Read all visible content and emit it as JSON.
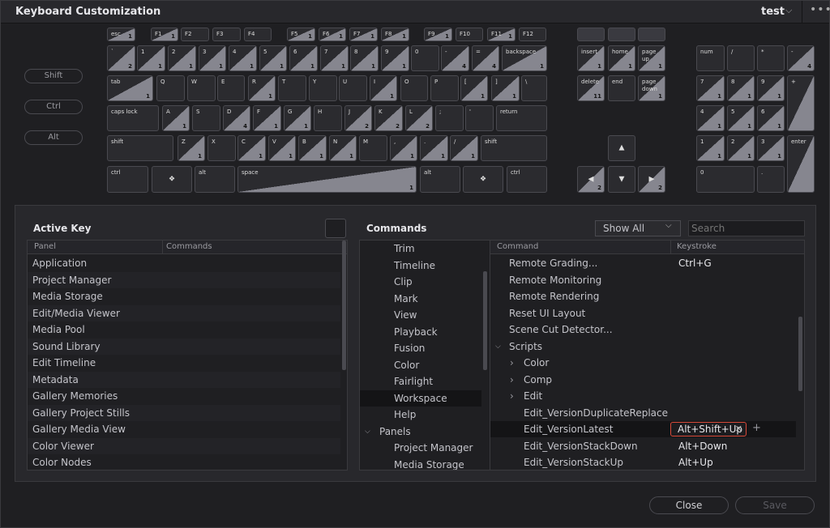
{
  "title": "Keyboard Customization",
  "preset": "test",
  "modifiers": [
    "Shift",
    "Ctrl",
    "Alt"
  ],
  "keys": [
    [
      "esc",
      "1",
      1
    ],
    [
      "F1",
      "1",
      1
    ],
    [
      "F2",
      "",
      0
    ],
    [
      "F3",
      "",
      0
    ],
    [
      "F4",
      "",
      0
    ],
    [
      "F5",
      "1",
      1
    ],
    [
      "F6",
      "1",
      1
    ],
    [
      "F7",
      "1",
      1
    ],
    [
      "F8",
      "1",
      1
    ],
    [
      "F9",
      "1",
      1
    ],
    [
      "F10",
      "",
      0
    ],
    [
      "F11",
      "1",
      1
    ],
    [
      "F12",
      "",
      0
    ],
    [
      "",
      "",
      0
    ],
    [
      "",
      "",
      0
    ],
    [
      "",
      "",
      0
    ],
    [
      "`",
      "2",
      1
    ],
    [
      "1",
      "1",
      1
    ],
    [
      "2",
      "1",
      1
    ],
    [
      "3",
      "1",
      1
    ],
    [
      "4",
      "1",
      1
    ],
    [
      "5",
      "1",
      1
    ],
    [
      "6",
      "1",
      1
    ],
    [
      "7",
      "1",
      1
    ],
    [
      "8",
      "1",
      1
    ],
    [
      "9",
      "1",
      1
    ],
    [
      "0",
      "",
      0
    ],
    [
      "-",
      "4",
      1
    ],
    [
      "=",
      "4",
      1
    ],
    [
      "backspace",
      "1",
      1
    ],
    [
      "insert",
      "1",
      1
    ],
    [
      "home",
      "1",
      1
    ],
    [
      "page up",
      "1",
      1
    ],
    [
      "num",
      "",
      0
    ],
    [
      "/",
      "",
      0
    ],
    [
      "*",
      "",
      0
    ],
    [
      "-",
      "4",
      1
    ],
    [
      "tab",
      "1",
      1
    ],
    [
      "Q",
      "",
      0
    ],
    [
      "W",
      "",
      0
    ],
    [
      "E",
      "",
      0
    ],
    [
      "R",
      "1",
      1
    ],
    [
      "T",
      "",
      0
    ],
    [
      "Y",
      "",
      0
    ],
    [
      "U",
      "",
      0
    ],
    [
      "I",
      "1",
      1
    ],
    [
      "O",
      "",
      0
    ],
    [
      "P",
      "",
      0
    ],
    [
      "[",
      "1",
      1
    ],
    [
      "]",
      "1",
      1
    ],
    [
      "\\",
      "",
      0
    ],
    [
      "delete",
      "11",
      1
    ],
    [
      "end",
      "",
      0
    ],
    [
      "page\ndown",
      "1",
      1
    ],
    [
      "7",
      "1",
      1
    ],
    [
      "8",
      "1",
      1
    ],
    [
      "9",
      "1",
      1
    ],
    [
      "+",
      "",
      1
    ],
    [
      "caps lock",
      "",
      0
    ],
    [
      "A",
      "1",
      1
    ],
    [
      "S",
      "",
      0
    ],
    [
      "D",
      "4",
      1
    ],
    [
      "F",
      "1",
      1
    ],
    [
      "G",
      "1",
      1
    ],
    [
      "H",
      "",
      0
    ],
    [
      "J",
      "2",
      1
    ],
    [
      "K",
      "2",
      1
    ],
    [
      "L",
      "2",
      1
    ],
    [
      ";",
      "",
      0
    ],
    [
      "'",
      "",
      0
    ],
    [
      "return",
      "",
      0
    ],
    [
      "4",
      "1",
      1
    ],
    [
      "5",
      "1",
      1
    ],
    [
      "6",
      "1",
      1
    ],
    [
      "shift",
      "",
      0
    ],
    [
      "Z",
      "1",
      1
    ],
    [
      "X",
      "",
      0
    ],
    [
      "C",
      "1",
      1
    ],
    [
      "V",
      "1",
      1
    ],
    [
      "B",
      "1",
      1
    ],
    [
      "N",
      "1",
      1
    ],
    [
      "M",
      "",
      0
    ],
    [
      ",",
      "1",
      1
    ],
    [
      ".",
      "1",
      1
    ],
    [
      "/",
      "1",
      1
    ],
    [
      "shift",
      "",
      0
    ],
    [
      "▲",
      "",
      0
    ],
    [
      "1",
      "1",
      1
    ],
    [
      "2",
      "1",
      1
    ],
    [
      "3",
      "1",
      1
    ],
    [
      "enter",
      "",
      1
    ],
    [
      "ctrl",
      "",
      0
    ],
    [
      "❖",
      "",
      0
    ],
    [
      "alt",
      "",
      0
    ],
    [
      "space",
      "1",
      1
    ],
    [
      "alt",
      "",
      0
    ],
    [
      "❖",
      "",
      0
    ],
    [
      "ctrl",
      "",
      0
    ],
    [
      "◀",
      "2",
      1
    ],
    [
      "▼",
      "",
      0
    ],
    [
      "▶",
      "2",
      1
    ],
    [
      "0",
      "",
      0
    ],
    [
      ".",
      "",
      0
    ]
  ],
  "active_key": {
    "title": "Active Key",
    "col_panel": "Panel",
    "col_commands": "Commands",
    "rows": [
      "Application",
      "Project Manager",
      "Media Storage",
      "Edit/Media Viewer",
      "Media Pool",
      "Sound Library",
      "Edit Timeline",
      "Metadata",
      "Gallery Memories",
      "Gallery Project Stills",
      "Gallery Media View",
      "Color Viewer",
      "Color Nodes"
    ]
  },
  "commands": {
    "title": "Commands",
    "filter": "Show All",
    "search_placeholder": "Search",
    "tree": [
      "Trim",
      "Timeline",
      "Clip",
      "Mark",
      "View",
      "Playback",
      "Fusion",
      "Color",
      "Fairlight",
      "Workspace",
      "Help",
      "Panels",
      "Project Manager",
      "Media Storage"
    ],
    "col_command": "Command",
    "col_keystroke": "Keystroke",
    "rows": [
      {
        "cmd": "Remote Grading...",
        "key": "Ctrl+G"
      },
      {
        "cmd": "Remote Monitoring",
        "key": ""
      },
      {
        "cmd": "Remote Rendering",
        "key": ""
      },
      {
        "cmd": "Reset UI Layout",
        "key": ""
      },
      {
        "cmd": "Scene Cut Detector...",
        "key": ""
      },
      {
        "cmd": "Scripts",
        "key": ""
      },
      {
        "cmd": "Color",
        "key": ""
      },
      {
        "cmd": "Comp",
        "key": ""
      },
      {
        "cmd": "Edit",
        "key": ""
      },
      {
        "cmd": "Edit_VersionDuplicateReplace",
        "key": ""
      },
      {
        "cmd": "Edit_VersionLatest",
        "key": "Alt+Shift+Up"
      },
      {
        "cmd": "Edit_VersionStackDown",
        "key": "Alt+Down"
      },
      {
        "cmd": "Edit_VersionStackUp",
        "key": "Alt+Up"
      }
    ]
  },
  "buttons": {
    "close": "Close",
    "save": "Save"
  }
}
